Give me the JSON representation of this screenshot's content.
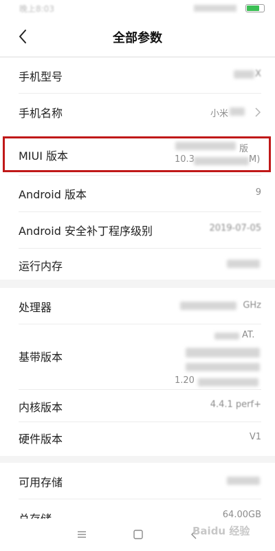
{
  "status_bar": {
    "time": "晚上8:03",
    "battery_color": "#3cbf55",
    "battery_level": 0.75
  },
  "header": {
    "back_icon": "chevron-left-icon",
    "title": "全部参数"
  },
  "section1": [
    {
      "label": "手机型号",
      "value": "X"
    },
    {
      "label": "手机名称",
      "value": "小米"
    },
    {
      "label": "MIUI 版本",
      "value_line1": "版",
      "value_line2_start": "10.3",
      "value_line2_end": "M)"
    },
    {
      "label": "Android 版本",
      "value": "9"
    },
    {
      "label": "Android 安全补丁程序级别",
      "value": "2019-07-05"
    },
    {
      "label": "运行内存",
      "value": ""
    }
  ],
  "section2": [
    {
      "label": "处理器",
      "value": "GHz"
    },
    {
      "label": "基带版本",
      "value_line1": "AT.",
      "value_line3": "1.20"
    },
    {
      "label": "内核版本",
      "value": "4.4.1  perf+"
    },
    {
      "label": "硬件版本",
      "value": "V1"
    }
  ],
  "section3": [
    {
      "label": "可用存储",
      "value": ""
    },
    {
      "label": "总存储",
      "value": "64.00GB"
    }
  ],
  "nav": {
    "menu_icon": "menu-icon",
    "home_icon": "home-icon",
    "back_icon": "back-triangle-icon"
  },
  "watermark": "Baidu 经验",
  "highlight_color": "#c01818"
}
